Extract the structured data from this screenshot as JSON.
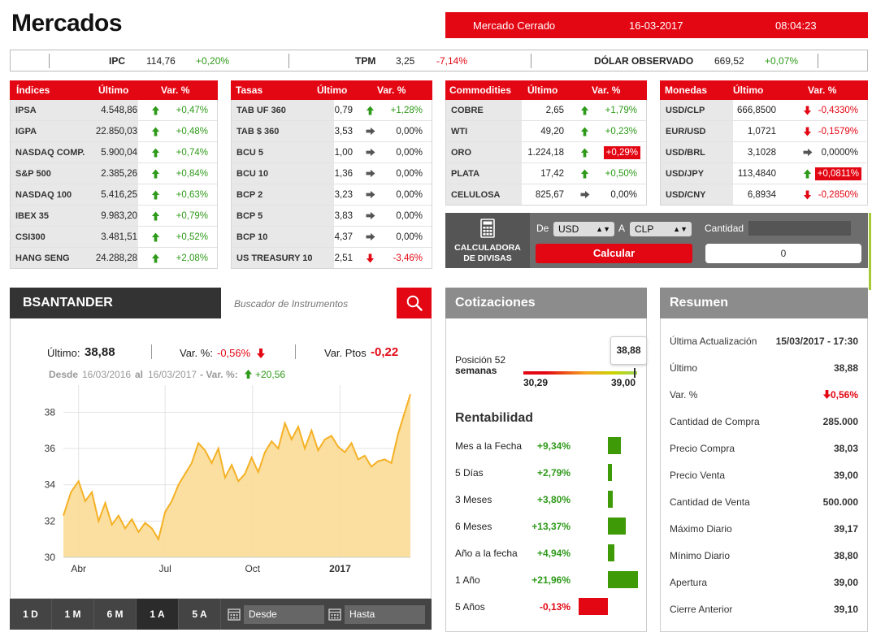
{
  "page_title": "Mercados",
  "status": {
    "market": "Mercado Cerrado",
    "date": "16-03-2017",
    "time": "08:04:23"
  },
  "ticker": [
    {
      "label": "IPC",
      "value": "114,76",
      "change": "+0,20%",
      "dir": "up"
    },
    {
      "label": "TPM",
      "value": "3,25",
      "change": "-7,14%",
      "dir": "down"
    },
    {
      "label": "DÓLAR OBSERVADO",
      "value": "669,52",
      "change": "+0,07%",
      "dir": "up"
    }
  ],
  "headers": {
    "ultimo": "Último",
    "var": "Var. %"
  },
  "indices": {
    "title": "Índices",
    "rows": [
      {
        "name": "IPSA",
        "value": "4.548,86",
        "change": "+0,47%",
        "dir": "up"
      },
      {
        "name": "IGPA",
        "value": "22.850,03",
        "change": "+0,48%",
        "dir": "up"
      },
      {
        "name": "NASDAQ COMP.",
        "value": "5.900,04",
        "change": "+0,74%",
        "dir": "up"
      },
      {
        "name": "S&P 500",
        "value": "2.385,26",
        "change": "+0,84%",
        "dir": "up"
      },
      {
        "name": "NASDAQ 100",
        "value": "5.416,25",
        "change": "+0,63%",
        "dir": "up"
      },
      {
        "name": "IBEX 35",
        "value": "9.983,20",
        "change": "+0,79%",
        "dir": "up"
      },
      {
        "name": "CSI300",
        "value": "3.481,51",
        "change": "+0,52%",
        "dir": "up"
      },
      {
        "name": "HANG SENG",
        "value": "24.288,28",
        "change": "+2,08%",
        "dir": "up"
      }
    ]
  },
  "tasas": {
    "title": "Tasas",
    "rows": [
      {
        "name": "TAB UF 360",
        "value": "0,79",
        "change": "+1,28%",
        "dir": "up"
      },
      {
        "name": "TAB $ 360",
        "value": "3,53",
        "change": "0,00%",
        "dir": "flat"
      },
      {
        "name": "BCU 5",
        "value": "1,00",
        "change": "0,00%",
        "dir": "flat"
      },
      {
        "name": "BCU 10",
        "value": "1,36",
        "change": "0,00%",
        "dir": "flat"
      },
      {
        "name": "BCP 2",
        "value": "3,23",
        "change": "0,00%",
        "dir": "flat"
      },
      {
        "name": "BCP 5",
        "value": "3,83",
        "change": "0,00%",
        "dir": "flat"
      },
      {
        "name": "BCP 10",
        "value": "4,37",
        "change": "0,00%",
        "dir": "flat"
      },
      {
        "name": "US TREASURY 10",
        "value": "2,51",
        "change": "-3,46%",
        "dir": "down"
      }
    ]
  },
  "commodities": {
    "title": "Commodities",
    "rows": [
      {
        "name": "COBRE",
        "value": "2,65",
        "change": "+1,79%",
        "dir": "up"
      },
      {
        "name": "WTI",
        "value": "49,20",
        "change": "+0,23%",
        "dir": "up"
      },
      {
        "name": "ORO",
        "value": "1.224,18",
        "change": "+0,29%",
        "dir": "up",
        "highlight": true
      },
      {
        "name": "PLATA",
        "value": "17,42",
        "change": "+0,50%",
        "dir": "up"
      },
      {
        "name": "CELULOSA",
        "value": "825,67",
        "change": "0,00%",
        "dir": "flat"
      }
    ]
  },
  "monedas": {
    "title": "Monedas",
    "rows": [
      {
        "name": "USD/CLP",
        "value": "666,8500",
        "change": "-0,4330%",
        "dir": "down"
      },
      {
        "name": "EUR/USD",
        "value": "1,0721",
        "change": "-0,1579%",
        "dir": "down"
      },
      {
        "name": "USD/BRL",
        "value": "3,1028",
        "change": "0,0000%",
        "dir": "flat"
      },
      {
        "name": "USD/JPY",
        "value": "113,4840",
        "change": "+0,0811%",
        "dir": "up",
        "highlight": true
      },
      {
        "name": "USD/CNY",
        "value": "6,8934",
        "change": "-0,2850%",
        "dir": "down"
      }
    ]
  },
  "calculator": {
    "title_line1": "CALCULADORA",
    "title_line2": "DE DIVISAS",
    "de_label": "De",
    "from": "USD",
    "a_label": "A",
    "to": "CLP",
    "qty_label": "Cantidad",
    "button": "Calcular",
    "result": "0"
  },
  "instrument": {
    "name": "BSANTANDER",
    "search_placeholder": "Buscador de Instrumentos",
    "ultimo_label": "Último:",
    "ultimo": "38,88",
    "var_label": "Var. %:",
    "var": "-0,56%",
    "ptos_label": "Var. Ptos",
    "ptos": "-0,22",
    "desde_label": "Desde",
    "desde": "16/03/2016",
    "al_label": "al",
    "al": "16/03/2017",
    "range_var_label": "- Var. %:",
    "range_var": "+20,56"
  },
  "periods": [
    {
      "label": "1 D",
      "active": false
    },
    {
      "label": "1 M",
      "active": false
    },
    {
      "label": "6 M",
      "active": false
    },
    {
      "label": "1 A",
      "active": true
    },
    {
      "label": "5 A",
      "active": false
    }
  ],
  "date_inputs": {
    "desde": "Desde",
    "hasta": "Hasta"
  },
  "chart_data": {
    "type": "area",
    "x_tick_labels": [
      "Abr",
      "Jul",
      "Oct",
      "2017"
    ],
    "y_ticks": [
      30,
      32,
      34,
      36,
      38
    ],
    "ylim": [
      30,
      39.5
    ],
    "grid": true,
    "color": "#f5b125",
    "fill": "#fbdc97",
    "x": [
      "2016-03-16",
      "2016-03-24",
      "2016-04-01",
      "2016-04-08",
      "2016-04-15",
      "2016-04-22",
      "2016-04-29",
      "2016-05-06",
      "2016-05-13",
      "2016-05-20",
      "2016-05-27",
      "2016-06-03",
      "2016-06-10",
      "2016-06-17",
      "2016-06-24",
      "2016-07-01",
      "2016-07-08",
      "2016-07-15",
      "2016-07-22",
      "2016-07-29",
      "2016-08-05",
      "2016-08-12",
      "2016-08-19",
      "2016-08-26",
      "2016-09-02",
      "2016-09-09",
      "2016-09-16",
      "2016-09-23",
      "2016-09-30",
      "2016-10-07",
      "2016-10-14",
      "2016-10-21",
      "2016-10-28",
      "2016-11-04",
      "2016-11-11",
      "2016-11-18",
      "2016-11-25",
      "2016-12-02",
      "2016-12-09",
      "2016-12-16",
      "2016-12-23",
      "2016-12-30",
      "2017-01-06",
      "2017-01-13",
      "2017-01-20",
      "2017-01-27",
      "2017-02-03",
      "2017-02-10",
      "2017-02-17",
      "2017-02-24",
      "2017-03-03",
      "2017-03-10",
      "2017-03-16"
    ],
    "values": [
      32.3,
      33.6,
      34.2,
      33.1,
      33.6,
      32.0,
      33.0,
      31.8,
      32.3,
      31.6,
      32.1,
      31.4,
      31.9,
      31.6,
      31.0,
      32.5,
      33.1,
      34.0,
      34.6,
      35.2,
      36.3,
      35.9,
      35.2,
      36.0,
      34.4,
      35.1,
      34.2,
      34.6,
      35.5,
      34.7,
      35.8,
      36.4,
      36.0,
      37.4,
      36.5,
      37.2,
      36.0,
      37.0,
      35.9,
      36.5,
      36.7,
      36.1,
      35.8,
      36.3,
      35.4,
      35.6,
      35.0,
      35.3,
      35.4,
      35.2,
      36.8,
      38.0,
      39.0
    ]
  },
  "cotizaciones": {
    "title": "Cotizaciones",
    "pos52_line1": "Posición 52",
    "pos52_line2": "semanas",
    "low": "30,29",
    "high": "39,00",
    "current": "38,88",
    "current_fraction": 0.987,
    "rentabilidad_title": "Rentabilidad",
    "rows": [
      {
        "label": "Mes a la Fecha",
        "value": "+9,34%",
        "pct": 9.34
      },
      {
        "label": "5 Días",
        "value": "+2,79%",
        "pct": 2.79
      },
      {
        "label": "3 Meses",
        "value": "+3,80%",
        "pct": 3.8
      },
      {
        "label": "6 Meses",
        "value": "+13,37%",
        "pct": 13.37
      },
      {
        "label": "Año a la fecha",
        "value": "+4,94%",
        "pct": 4.94
      },
      {
        "label": "1 Año",
        "value": "+21,96%",
        "pct": 21.96
      },
      {
        "label": "5 Años",
        "value": "-0,13%",
        "pct": -0.13
      }
    ]
  },
  "resumen": {
    "title": "Resumen",
    "rows": [
      {
        "label": "Última Actualización",
        "value": "15/03/2017 - 17:30"
      },
      {
        "label": "Último",
        "value": "38,88"
      },
      {
        "label": "Var. %",
        "value": "-0,56%",
        "neg": true
      },
      {
        "label": "Cantidad de Compra",
        "value": "285.000"
      },
      {
        "label": "Precio Compra",
        "value": "38,03"
      },
      {
        "label": "Precio Venta",
        "value": "39,00"
      },
      {
        "label": "Cantidad de Venta",
        "value": "500.000"
      },
      {
        "label": "Máximo Diario",
        "value": "39,17"
      },
      {
        "label": "Mínimo Diario",
        "value": "38,80"
      },
      {
        "label": "Apertura",
        "value": "39,00"
      },
      {
        "label": "Cierre Anterior",
        "value": "39,10"
      }
    ]
  },
  "colors": {
    "accent": "#e30613",
    "up": "#2e9a19",
    "down": "#e30613",
    "flat": "#555555",
    "panel_dark": "#333333",
    "panel_gray": "#8c8c8c"
  }
}
